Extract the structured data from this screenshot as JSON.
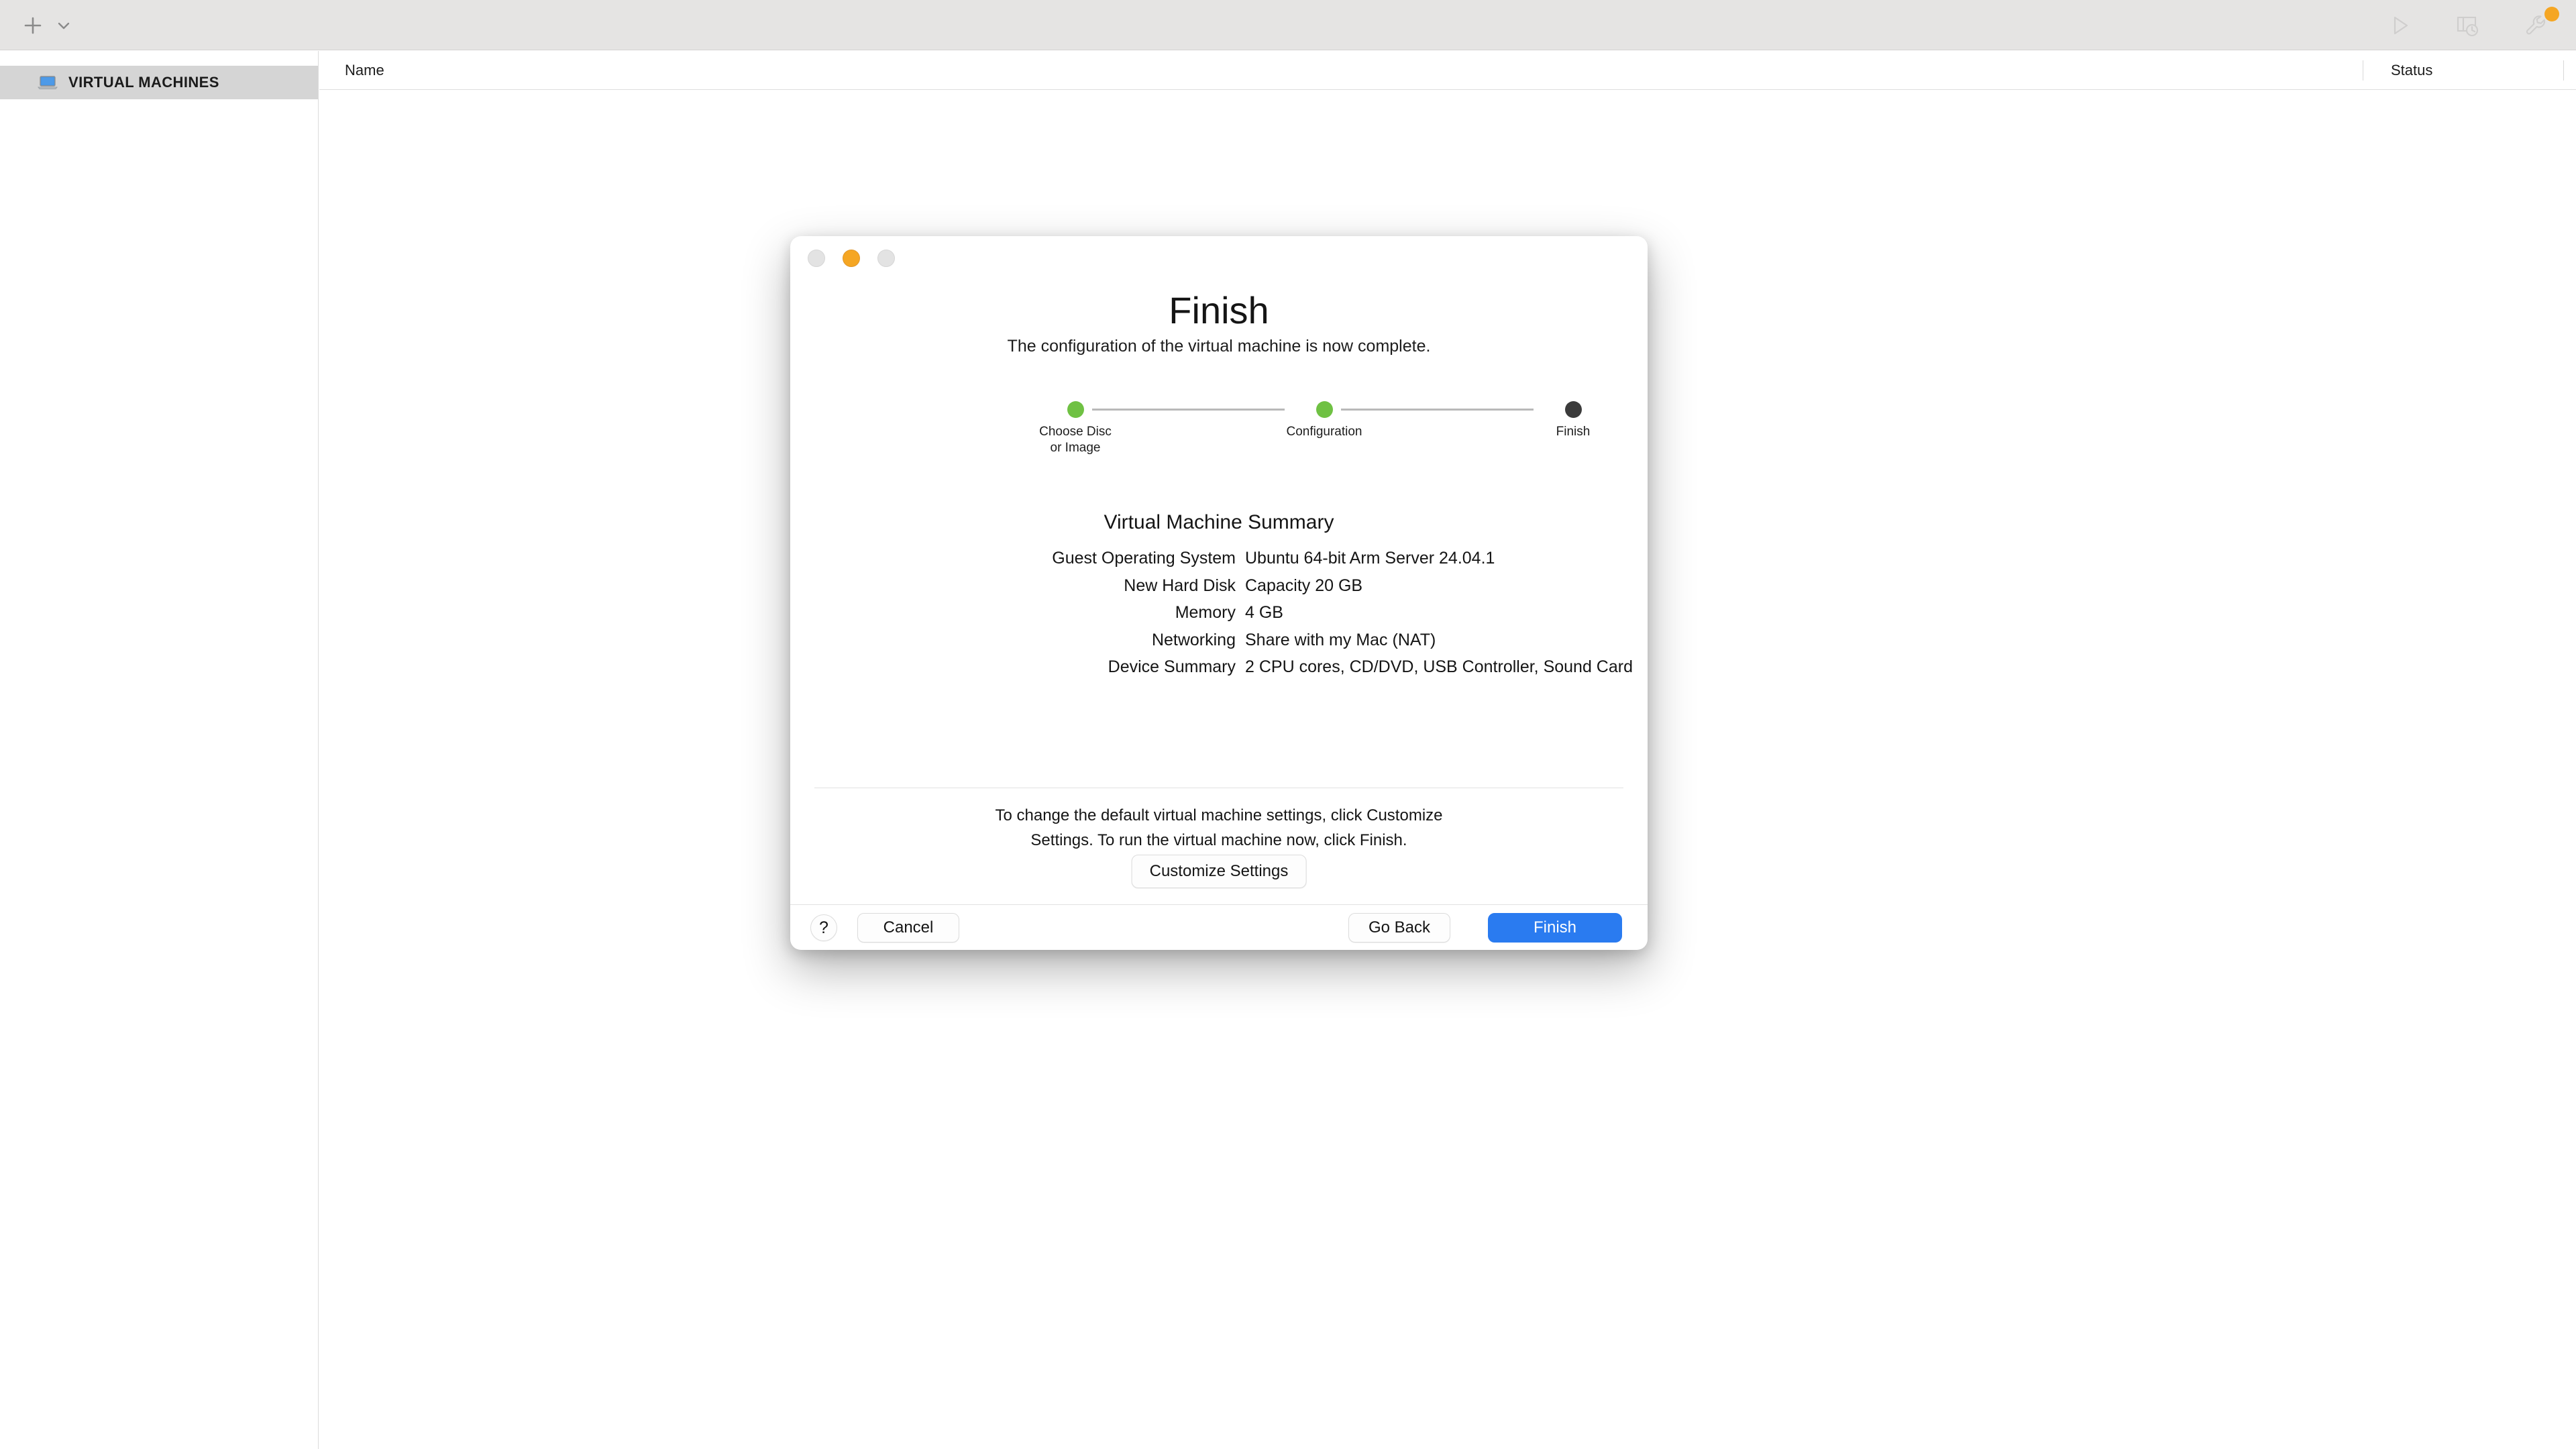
{
  "toolbar": {
    "add_icon": "plus-icon",
    "add_chevron_icon": "chevron-down-icon",
    "play_icon": "play-icon",
    "snapshot_icon": "snapshot-icon",
    "settings_icon": "wrench-icon",
    "settings_badge": "update-available-dot",
    "badge_color": "#f5a623"
  },
  "sidebar": {
    "items": [
      {
        "label": "VIRTUAL MACHINES",
        "icon": "laptop-icon",
        "selected": true
      }
    ]
  },
  "list": {
    "columns": [
      {
        "label": "Name"
      },
      {
        "label": "Status"
      }
    ],
    "rows": []
  },
  "dialog": {
    "window_controls": [
      {
        "name": "close",
        "state": "inactive"
      },
      {
        "name": "minimize",
        "state": "active"
      },
      {
        "name": "zoom",
        "state": "inactive"
      }
    ],
    "title": "Finish",
    "subtitle": "The configuration of the virtual machine is now complete.",
    "stepper": {
      "steps": [
        {
          "label": "Choose Disc\nor Image",
          "state": "done"
        },
        {
          "label": "Configuration",
          "state": "done"
        },
        {
          "label": "Finish",
          "state": "current"
        }
      ],
      "done_color": "#6fc143",
      "current_color": "#3b3b3b"
    },
    "summary": {
      "title": "Virtual Machine Summary",
      "rows": [
        {
          "key": "Guest Operating System",
          "value": "Ubuntu 64-bit Arm Server 24.04.1"
        },
        {
          "key": "New Hard Disk",
          "value": "Capacity 20 GB"
        },
        {
          "key": "Memory",
          "value": "4 GB"
        },
        {
          "key": "Networking",
          "value": "Share with my Mac (NAT)"
        },
        {
          "key": "Device Summary",
          "value": "2 CPU cores, CD/DVD, USB Controller, Sound Card"
        }
      ]
    },
    "hint": "To change the default virtual machine settings, click Customize Settings. To run the virtual machine now, click Finish.",
    "customize_label": "Customize Settings",
    "help_label": "?",
    "cancel_label": "Cancel",
    "go_back_label": "Go Back",
    "finish_label": "Finish",
    "finish_color": "#2a7bf0"
  }
}
